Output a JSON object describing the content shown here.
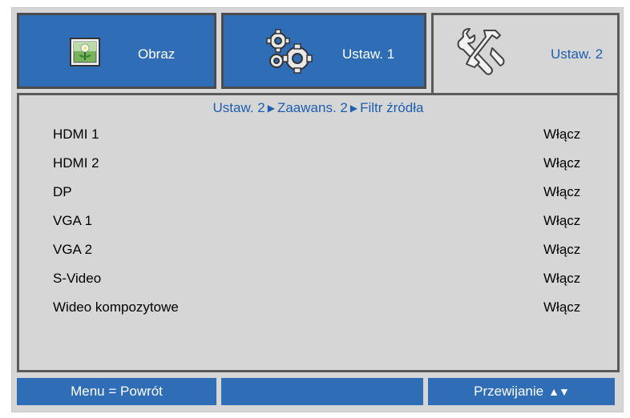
{
  "tabs": [
    {
      "label": "Obraz",
      "icon": "image-icon",
      "active": false
    },
    {
      "label": "Ustaw. 1",
      "icon": "gears-icon",
      "active": false
    },
    {
      "label": "Ustaw. 2",
      "icon": "tools-icon",
      "active": true
    }
  ],
  "breadcrumb": {
    "part1": "Ustaw. 2",
    "part2": "Zaawans. 2",
    "part3": "Filtr źródła"
  },
  "rows": [
    {
      "label": "HDMI 1",
      "value": "Włącz"
    },
    {
      "label": "HDMI 2",
      "value": "Włącz"
    },
    {
      "label": "DP",
      "value": "Włącz"
    },
    {
      "label": "VGA 1",
      "value": "Włącz"
    },
    {
      "label": "VGA 2",
      "value": "Włącz"
    },
    {
      "label": "S-Video",
      "value": "Włącz"
    },
    {
      "label": "Wideo kompozytowe",
      "value": "Włącz"
    }
  ],
  "footer": {
    "back": "Menu = Powrót",
    "middle": "",
    "scroll": "Przewijanie",
    "scroll_arrows": "▲▼"
  },
  "colors": {
    "tab_blue": "#2f6eb6",
    "panel_gray": "#d6d6d6",
    "active_text": "#1f5fb0"
  }
}
